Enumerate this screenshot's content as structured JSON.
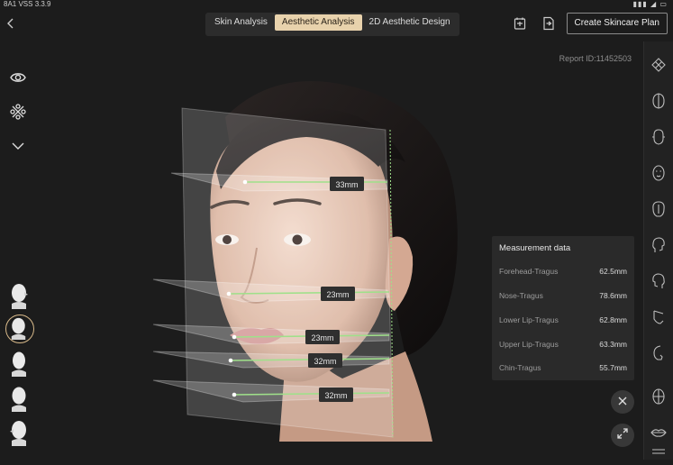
{
  "status": {
    "left": "8A1  VSS 3.3.9",
    "right": "▮▮▮ ◢ ▭"
  },
  "nav": {
    "back_icon": "back-chevron-icon",
    "tabs": [
      {
        "label": "Skin Analysis"
      },
      {
        "label": "Aesthetic Analysis"
      },
      {
        "label": "2D Aesthetic Design"
      }
    ],
    "create_plan_label": "Create Skincare Plan"
  },
  "report": {
    "id_text": "Report ID:11452503"
  },
  "left_toolbar": {
    "icons": [
      "eye-icon",
      "grid-icon",
      "chevron-down-icon"
    ]
  },
  "view_angles": [
    "head-right-profile",
    "head-three-quarter",
    "head-front",
    "head-left-three-quarter",
    "head-left-profile"
  ],
  "measurements": {
    "title": "Measurement data",
    "rows": [
      {
        "label": "Forehead-Tragus",
        "value": "62.5mm"
      },
      {
        "label": "Nose-Tragus",
        "value": "78.6mm"
      },
      {
        "label": "Lower Lip-Tragus",
        "value": "62.8mm"
      },
      {
        "label": "Upper Lip-Tragus",
        "value": "63.3mm"
      },
      {
        "label": "Chin-Tragus",
        "value": "55.7mm"
      }
    ]
  },
  "face_labels": [
    "33mm",
    "23mm",
    "23mm",
    "32mm",
    "32mm"
  ],
  "colors": {
    "accent": "#e8d2ac",
    "line_green": "#9fe08a",
    "panel_bg": "#2a2a2a"
  }
}
